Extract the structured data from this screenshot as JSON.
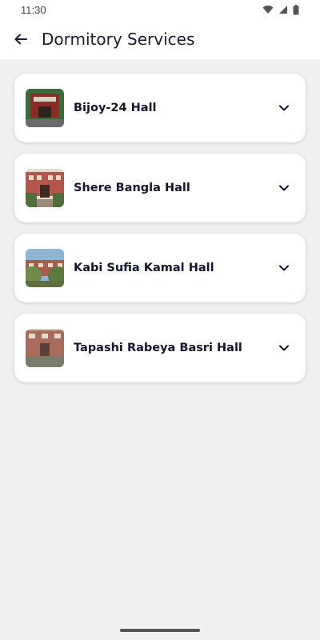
{
  "status_bar": {
    "time": "11:30"
  },
  "app_bar": {
    "title": "Dormitory Services"
  },
  "halls": [
    {
      "label": "Bijoy-24 Hall",
      "thumb_colors": [
        "#8c2b25",
        "#3a6b3a",
        "#d9d2c4"
      ]
    },
    {
      "label": "Shere Bangla Hall",
      "thumb_colors": [
        "#b4574a",
        "#4f6e3b",
        "#e8d9c8"
      ]
    },
    {
      "label": "Kabi Sufia Kamal Hall",
      "thumb_colors": [
        "#6f8a4a",
        "#a45f4c",
        "#8fb5d4"
      ]
    },
    {
      "label": "Tapashi Rabeya Basri Hall",
      "thumb_colors": [
        "#a86b5c",
        "#d8c8b6",
        "#7b7b6a"
      ]
    }
  ]
}
